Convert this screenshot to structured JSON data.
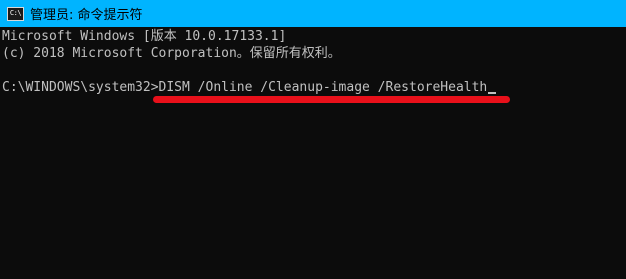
{
  "window": {
    "title": "管理员: 命令提示符",
    "icon_name": "cmd-icon",
    "icon_text": "C:\\"
  },
  "console": {
    "lines": [
      "Microsoft Windows [版本 10.0.17133.1]",
      "(c) 2018 Microsoft Corporation。保留所有权利。",
      "",
      "C:\\WINDOWS\\system32>DISM /Online /Cleanup-image /RestoreHealth"
    ]
  },
  "colors": {
    "titlebar": "#00b4ff",
    "console_bg": "#0c0c0c",
    "console_text": "#c0c0c0",
    "annotation": "#e8101a"
  }
}
